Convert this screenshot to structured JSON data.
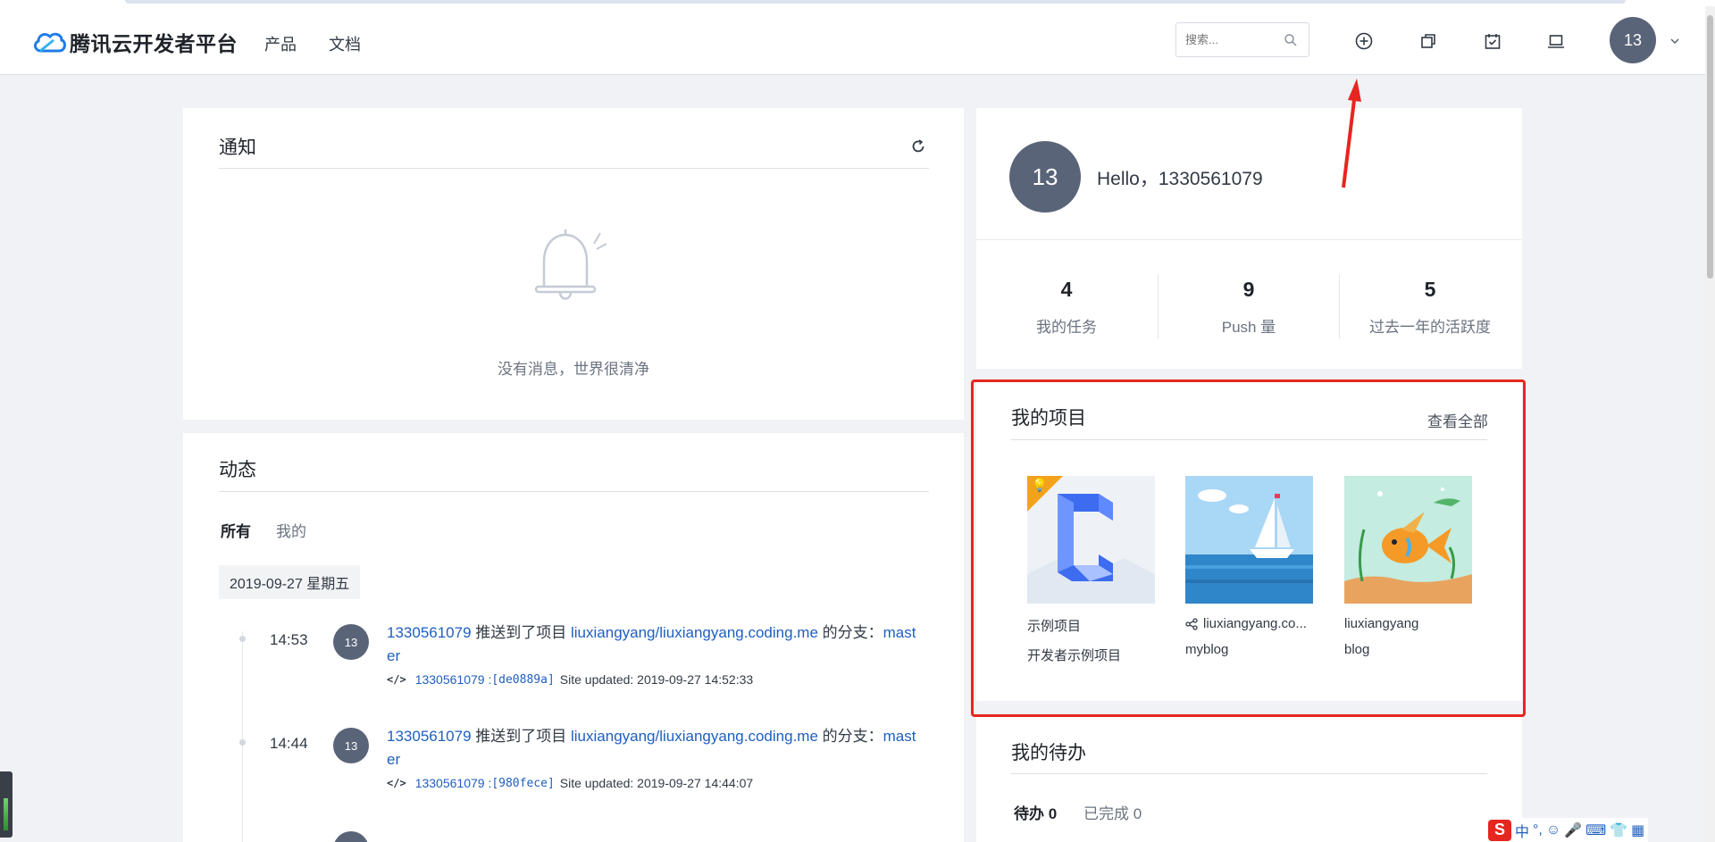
{
  "header": {
    "brand": "腾讯云开发者平台",
    "nav": [
      {
        "label": "产品"
      },
      {
        "label": "文档"
      }
    ],
    "search_placeholder": "搜索...",
    "icons": [
      "search-icon",
      "plus-circle-icon",
      "copy-icon",
      "task-check-icon",
      "laptop-icon",
      "chevron-down-icon"
    ],
    "avatar_text": "13"
  },
  "notifications": {
    "title": "通知",
    "empty_text": "没有消息，世界很清净",
    "refresh_icon": "refresh-icon",
    "bell_icon": "bell-icon"
  },
  "activity": {
    "title": "动态",
    "tabs": [
      {
        "label": "所有",
        "active": true
      },
      {
        "label": "我的",
        "active": false
      }
    ],
    "date": "2019-09-27 星期五",
    "entries": [
      {
        "time": "14:53",
        "avatar": "13",
        "user": "1330561079",
        "action": " 推送到了项目 ",
        "project": "liuxiangyang/liuxiangyang.coding.me",
        "suffix": " 的分支：",
        "branch": "master",
        "commit_user": "1330561079 : ",
        "commit_hash": "[de0889a]",
        "commit_msg": "Site updated: 2019-09-27 14:52:33"
      },
      {
        "time": "14:44",
        "avatar": "13",
        "user": "1330561079",
        "action": " 推送到了项目 ",
        "project": "liuxiangyang/liuxiangyang.coding.me",
        "suffix": " 的分支：",
        "branch": "master",
        "commit_user": "1330561079 : ",
        "commit_hash": "[980fece]",
        "commit_msg": "Site updated: 2019-09-27 14:44:07"
      }
    ]
  },
  "profile": {
    "avatar": "13",
    "greeting": "Hello，1330561079",
    "stats": [
      {
        "value": "4",
        "label": "我的任务"
      },
      {
        "value": "9",
        "label": "Push 量"
      },
      {
        "value": "5",
        "label": "过去一年的活跃度"
      }
    ]
  },
  "projects": {
    "title": "我的项目",
    "view_all": "查看全部",
    "items": [
      {
        "name": "示例项目",
        "desc": "开发者示例项目",
        "badge": "lightbulb-icon"
      },
      {
        "name": "liuxiangyang.co...",
        "desc": "myblog",
        "icon": "share-icon"
      },
      {
        "name": "liuxiangyang",
        "desc": "blog"
      }
    ]
  },
  "todo": {
    "title": "我的待办",
    "tabs": [
      {
        "label": "待办 0",
        "active": true
      },
      {
        "label": "已完成 0",
        "active": false
      }
    ]
  },
  "ime": {
    "logo": "S",
    "label": "中",
    "glyphs": [
      "°,",
      "☺",
      "🎤",
      "⌨",
      "👕",
      "▦"
    ]
  },
  "colors": {
    "accent": "#1f5fbf",
    "annotation": "#e6261f",
    "avatar": "#5a6478"
  }
}
